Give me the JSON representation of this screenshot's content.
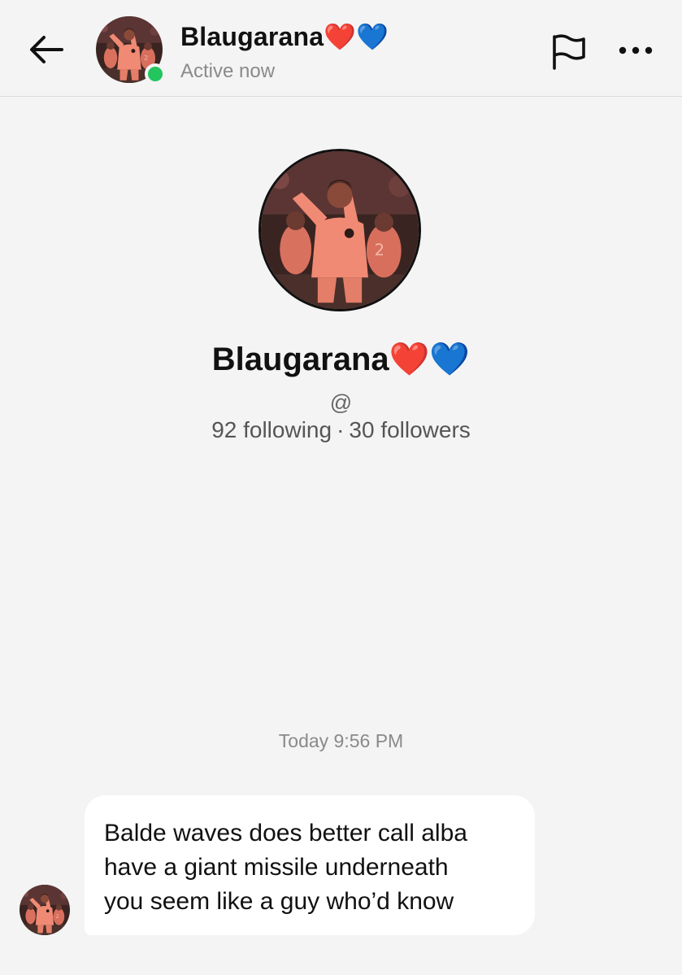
{
  "header": {
    "name": "Blaugarana❤️💙",
    "status": "Active now",
    "icons": {
      "back": "back-arrow-icon",
      "report": "flag-icon",
      "more": "more-options-icon"
    },
    "online_color": "#22c55e"
  },
  "profile": {
    "name": "Blaugarana❤️💙",
    "handle": "@",
    "following": "92 following",
    "separator": "·",
    "followers": "30 followers"
  },
  "conversation": {
    "timestamp": "Today 9:56 PM",
    "messages": [
      {
        "lines": [
          "Balde waves does better call alba",
          "have a giant missile underneath",
          "you seem like a guy who’d know"
        ]
      }
    ]
  }
}
